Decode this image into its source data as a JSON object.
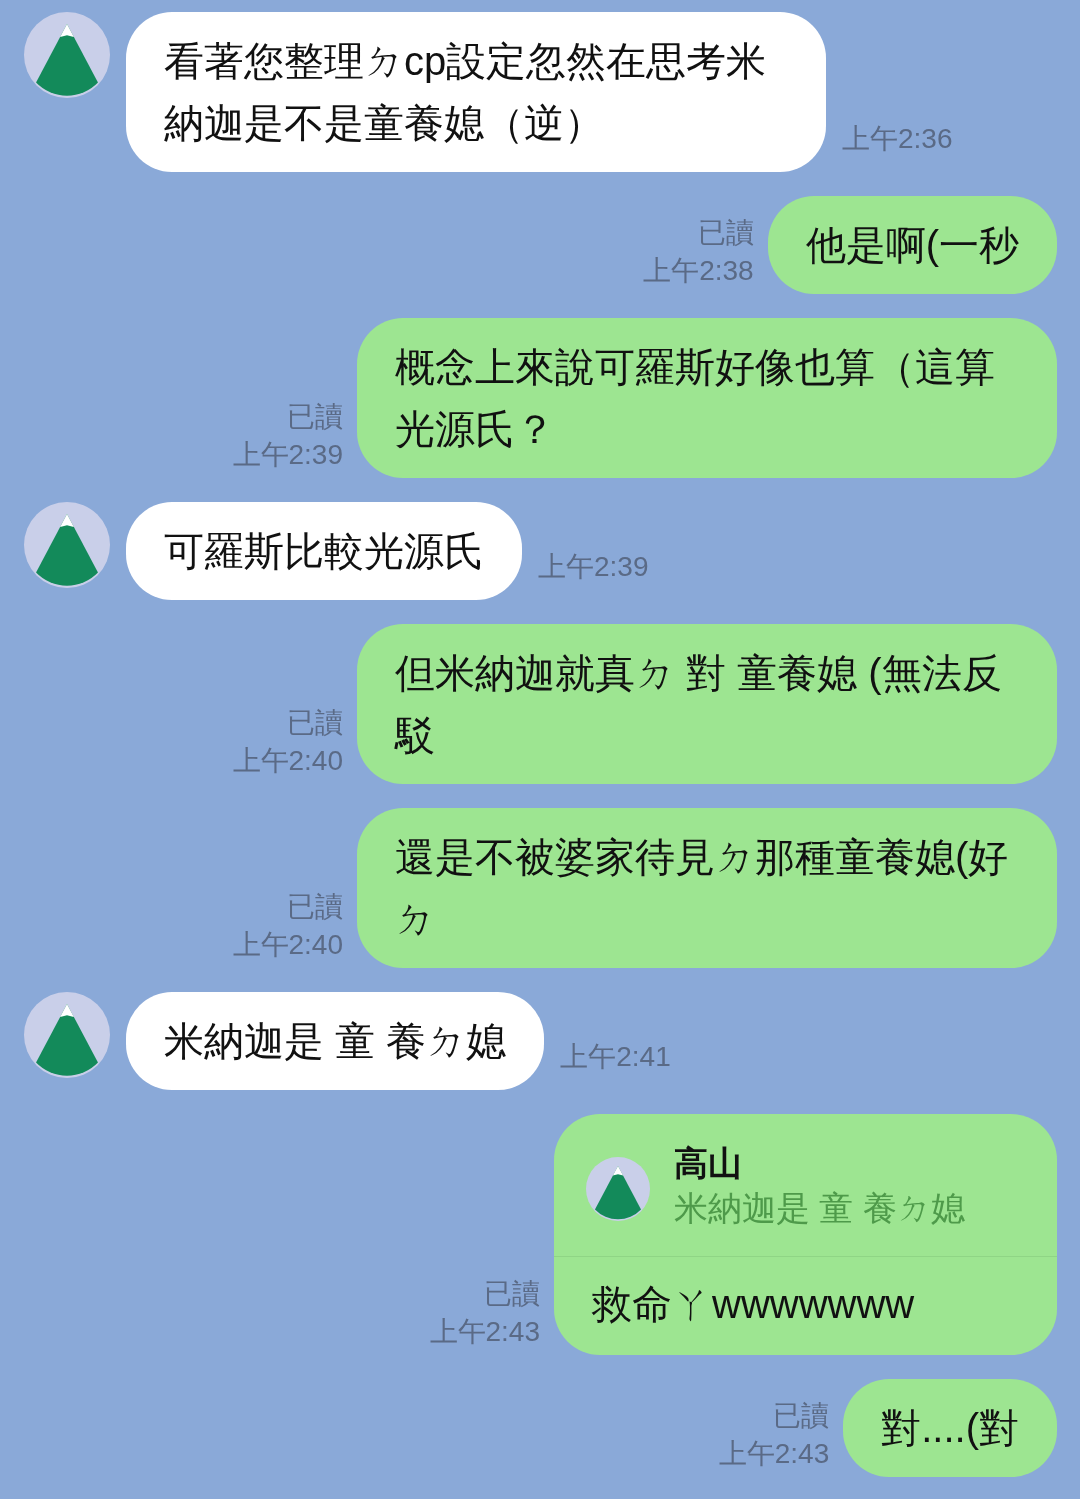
{
  "messages": [
    {
      "kind": "incoming",
      "text": "看著您整理ㄉcp設定忽然在思考米納迦是不是童養媳（逆）",
      "time": "上午2:36"
    },
    {
      "kind": "outgoing",
      "read": "已讀",
      "time": "上午2:38",
      "text": "他是啊(一秒"
    },
    {
      "kind": "outgoing",
      "read": "已讀",
      "time": "上午2:39",
      "text": "概念上來說可羅斯好像也算（這算光源氏？"
    },
    {
      "kind": "incoming",
      "text": "可羅斯比較光源氏",
      "time": "上午2:39"
    },
    {
      "kind": "outgoing",
      "read": "已讀",
      "time": "上午2:40",
      "text": "但米納迦就真ㄉ 對 童養媳 (無法反駁"
    },
    {
      "kind": "outgoing",
      "read": "已讀",
      "time": "上午2:40",
      "text": "還是不被婆家待見ㄉ那種童養媳(好ㄉ"
    },
    {
      "kind": "incoming",
      "text": "米納迦是 童 養ㄉ媳",
      "time": "上午2:41"
    },
    {
      "kind": "reply",
      "read": "已讀",
      "time": "上午2:43",
      "quote": {
        "name": "高山",
        "text": "米納迦是 童 養ㄉ媳"
      },
      "text": "救命ㄚwwwwwww"
    },
    {
      "kind": "outgoing",
      "read": "已讀",
      "time": "上午2:43",
      "text": "對....(對"
    }
  ]
}
